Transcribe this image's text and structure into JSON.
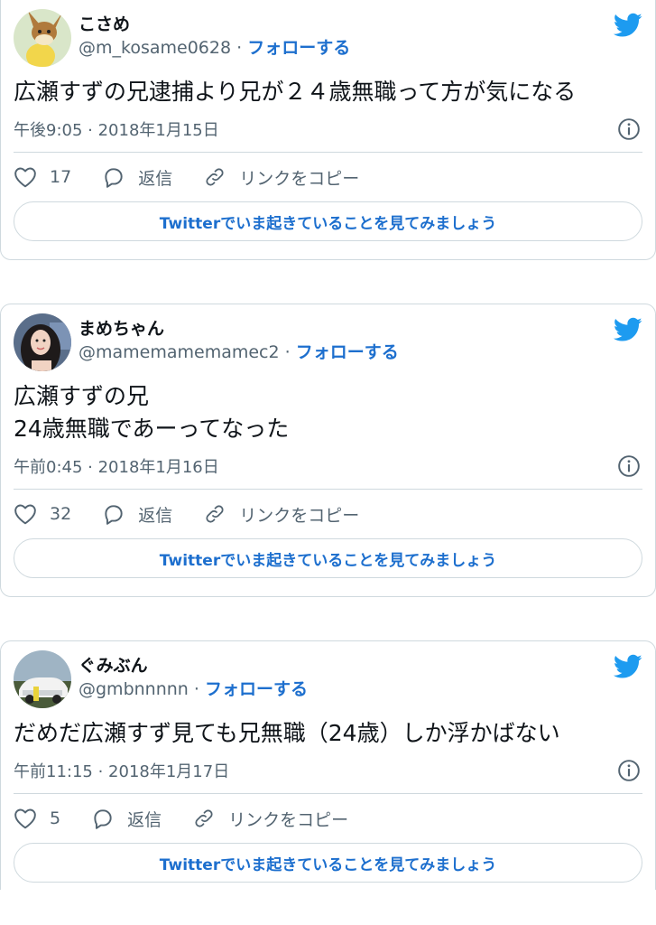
{
  "colors": {
    "twitter_blue": "#1d9bf0",
    "link_blue": "#1d6fce",
    "text_secondary": "#536471",
    "border": "#cfd9de"
  },
  "tweets": [
    {
      "display_name": "こさめ",
      "handle": "@m_kosame0628",
      "separator": "·",
      "follow_label": "フォローする",
      "text": "広瀬すずの兄逮捕より兄が２４歳無職って方が気になる",
      "timestamp": "午後9:05 · 2018年1月15日",
      "like_count": "17",
      "reply_label": "返信",
      "copy_link_label": "リンクをコピー",
      "cta_label": "Twitterでいま起きていることを見てみましょう",
      "avatar_icon": "pikachu-eevee-avatar"
    },
    {
      "display_name": "まめちゃん",
      "handle": "@mamemamemamec2",
      "separator": "·",
      "follow_label": "フォローする",
      "text": "広瀬すずの兄\n24歳無職であーってなった",
      "timestamp": "午前0:45 · 2018年1月16日",
      "like_count": "32",
      "reply_label": "返信",
      "copy_link_label": "リンクをコピー",
      "cta_label": "Twitterでいま起きていることを見てみましょう",
      "avatar_icon": "person-photo-avatar"
    },
    {
      "display_name": "ぐみぶん",
      "handle": "@gmbnnnnn",
      "separator": "·",
      "follow_label": "フォローする",
      "text": "だめだ広瀬すず見ても兄無職（24歳）しか浮かばない",
      "timestamp": "午前11:15 · 2018年1月17日",
      "like_count": "5",
      "reply_label": "返信",
      "copy_link_label": "リンクをコピー",
      "cta_label": "Twitterでいま起きていることを見てみましょう",
      "avatar_icon": "car-photo-avatar"
    }
  ]
}
